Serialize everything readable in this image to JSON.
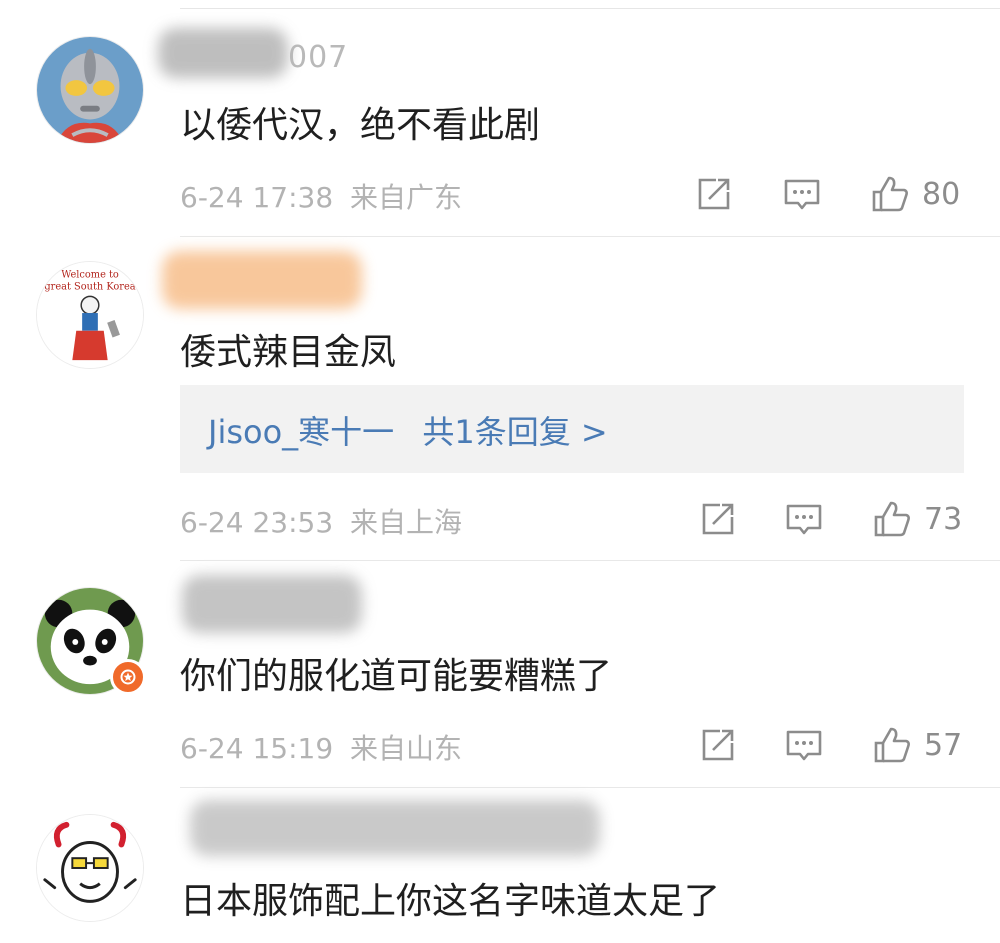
{
  "comments": [
    {
      "username_visible": "007",
      "text": "以倭代汉，绝不看此剧",
      "time": "6-24 17:38",
      "location": "来自广东",
      "likes": "80",
      "avatar": "ultraman-avatar",
      "colors": {
        "blur": "#8a8a8a"
      }
    },
    {
      "username_visible": "",
      "text": "倭式辣目金凤",
      "reply": {
        "user": "Jisoo_寒十一",
        "summary": "共1条回复 >"
      },
      "time": "6-24 23:53",
      "location": "来自上海",
      "likes": "73",
      "avatar": "cartoon-avatar",
      "avatar_text": [
        "Welcome to",
        "great South Korea"
      ],
      "colors": {
        "blur": "#f4a35a"
      }
    },
    {
      "username_visible": "",
      "text": "你们的服化道可能要糟糕了",
      "time": "6-24 15:19",
      "location": "来自山东",
      "likes": "57",
      "avatar": "panda-avatar",
      "badge": "verified-badge-icon",
      "colors": {
        "blur": "#8a8a8a"
      }
    },
    {
      "username_visible": "",
      "text": "日本服饰配上你这名字味道太足了",
      "avatar": "cow-avatar",
      "colors": {
        "blur": "#8a8a8a"
      }
    }
  ],
  "colors": {
    "link": "#4a7bb5",
    "meta": "#b3b3b3",
    "reply_bg": "#f2f2f2",
    "badge": "#f06a2a"
  },
  "icons": [
    "share-icon",
    "comment-icon",
    "like-icon"
  ]
}
